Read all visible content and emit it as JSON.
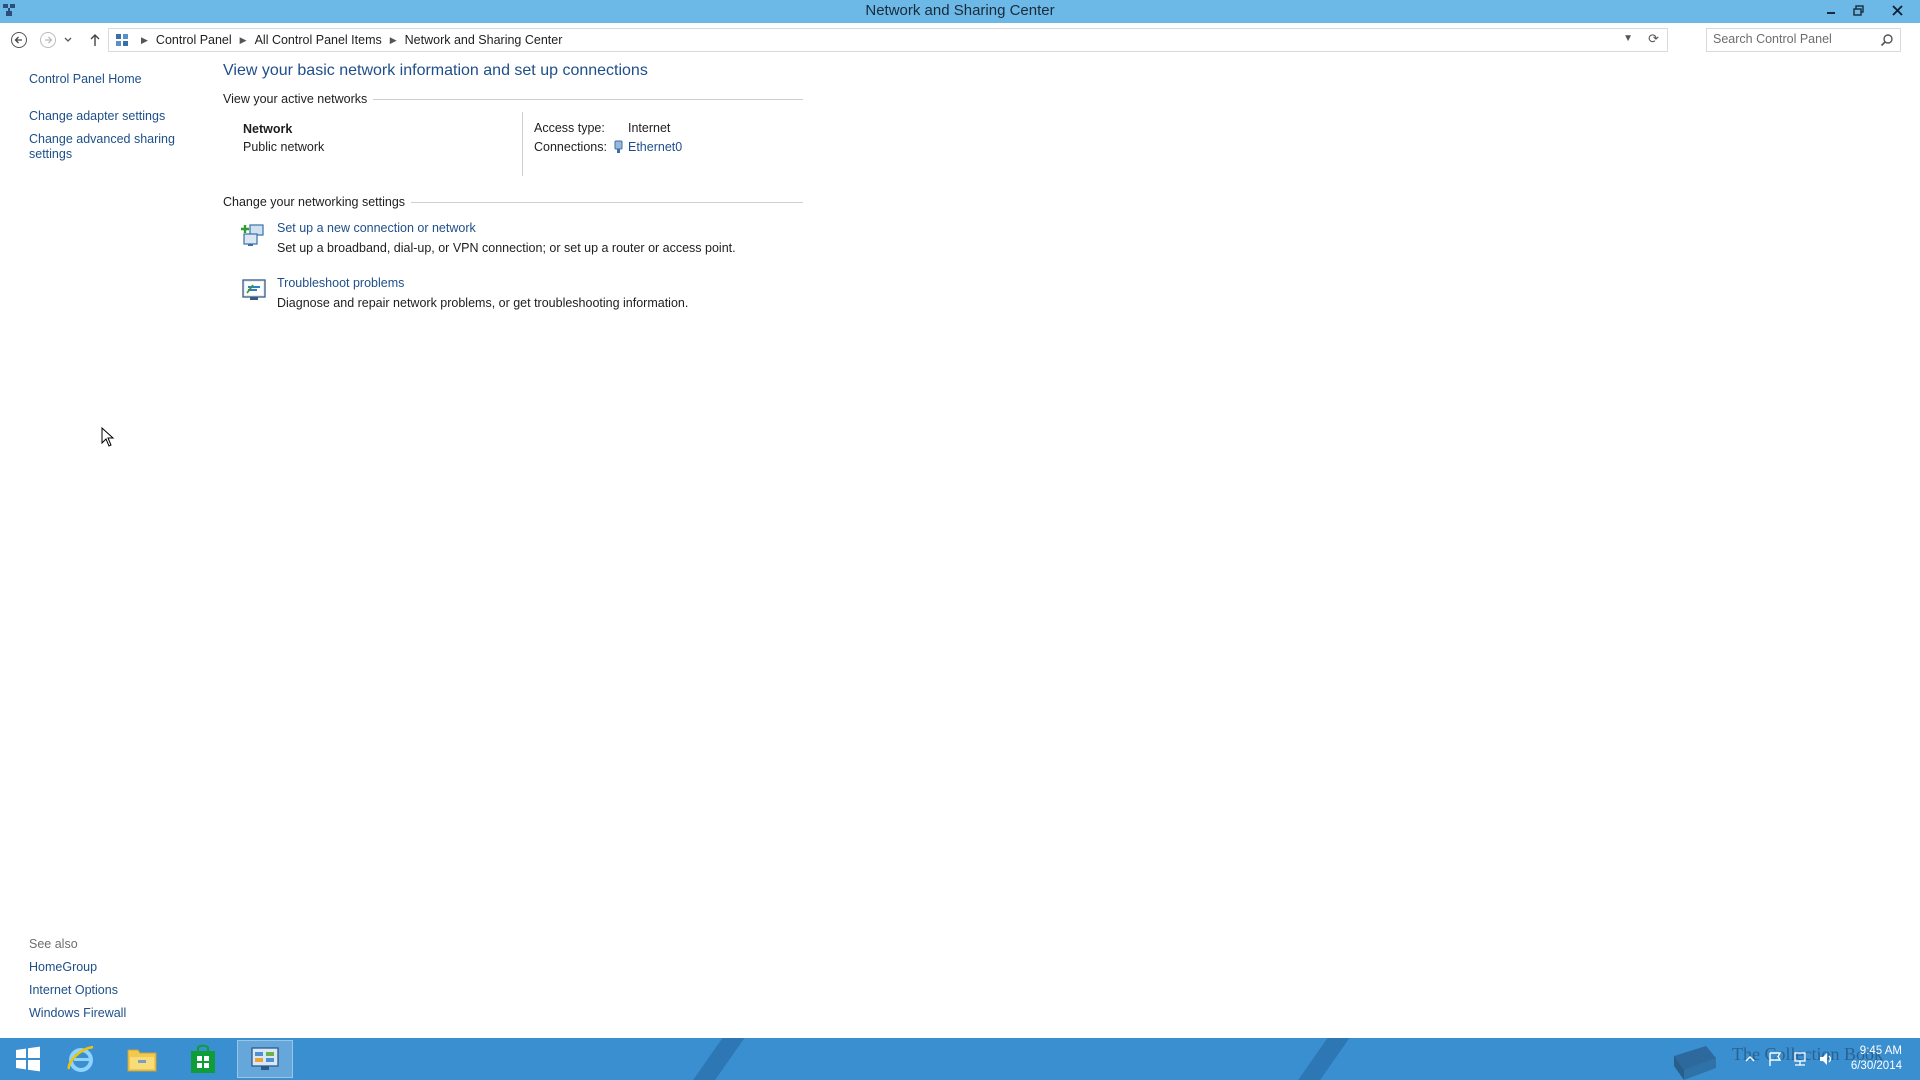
{
  "window": {
    "title": "Network and Sharing Center",
    "controls": {
      "minimize": "minimize",
      "restore": "restore",
      "close": "close"
    }
  },
  "navbar": {
    "breadcrumbs": [
      "Control Panel",
      "All Control Panel Items",
      "Network and Sharing Center"
    ],
    "search_placeholder": "Search Control Panel"
  },
  "left_pane": {
    "home": "Control Panel Home",
    "links": [
      "Change adapter settings",
      "Change advanced sharing settings"
    ]
  },
  "see_also": {
    "header": "See also",
    "links": [
      "HomeGroup",
      "Internet Options",
      "Windows Firewall"
    ]
  },
  "main": {
    "title": "View your basic network information and set up connections",
    "active_networks_header": "View your active networks",
    "network": {
      "name": "Network",
      "type": "Public network",
      "access_type_label": "Access type:",
      "access_type_value": "Internet",
      "connections_label": "Connections:",
      "connections_value": "Ethernet0"
    },
    "change_settings_header": "Change your networking settings",
    "tasks": [
      {
        "link": "Set up a new connection or network",
        "desc": "Set up a broadband, dial-up, or VPN connection; or set up a router or access point.",
        "icon": "new-connection-icon"
      },
      {
        "link": "Troubleshoot problems",
        "desc": "Diagnose and repair network problems, or get troubleshooting information.",
        "icon": "troubleshoot-icon"
      }
    ]
  },
  "taskbar": {
    "apps": [
      "start-icon",
      "internet-explorer-icon",
      "file-explorer-icon",
      "store-icon",
      "control-panel-icon"
    ],
    "watermark": "The Collection Book",
    "time": "9:45 AM",
    "date": "6/30/2014"
  },
  "colors": {
    "titlebar": "#6cb8e6",
    "link": "#1e4f8a",
    "taskbar": "#3a8fd1"
  }
}
